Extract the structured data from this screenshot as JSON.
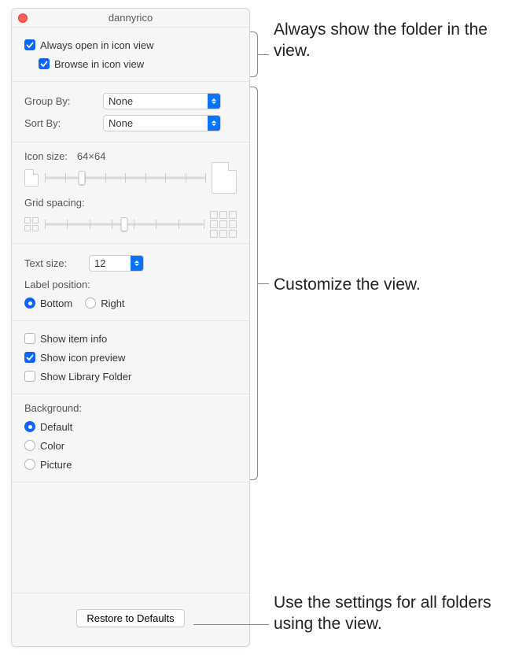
{
  "window": {
    "title": "dannyrico"
  },
  "always_open": {
    "label": "Always open in icon view"
  },
  "browse": {
    "label": "Browse in icon view"
  },
  "group_by": {
    "label": "Group By:",
    "value": "None"
  },
  "sort_by": {
    "label": "Sort By:",
    "value": "None"
  },
  "icon_size": {
    "label": "Icon size:",
    "value": "64×64"
  },
  "grid_spacing": {
    "label": "Grid spacing:"
  },
  "text_size": {
    "label": "Text size:",
    "value": "12"
  },
  "label_position": {
    "label": "Label position:",
    "bottom": "Bottom",
    "right": "Right"
  },
  "show_info": {
    "label": "Show item info"
  },
  "show_preview": {
    "label": "Show icon preview"
  },
  "show_library": {
    "label": "Show Library Folder"
  },
  "background": {
    "label": "Background:",
    "default": "Default",
    "color": "Color",
    "picture": "Picture"
  },
  "restore": {
    "label": "Restore to Defaults"
  },
  "annotations": {
    "a1": "Always show the folder in the view.",
    "a2": "Customize the view.",
    "a3": "Use the settings for all folders using the view."
  }
}
